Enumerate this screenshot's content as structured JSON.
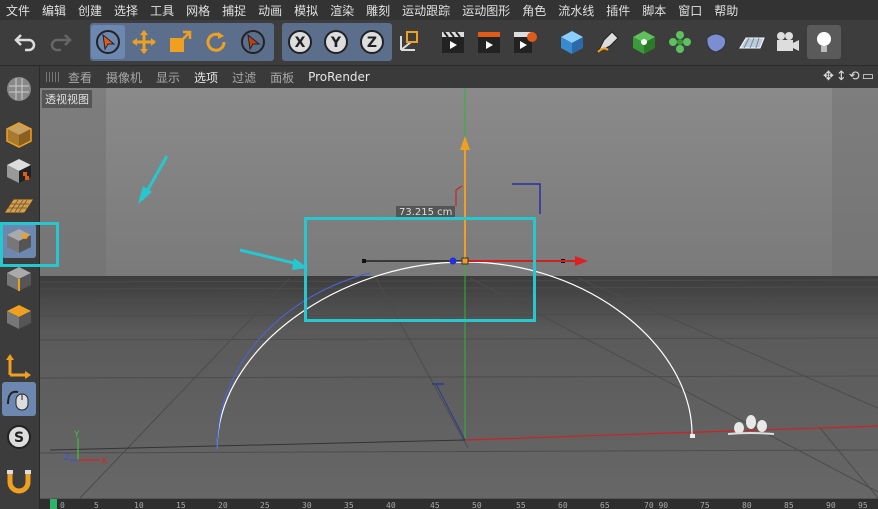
{
  "menu": [
    "文件",
    "编辑",
    "创建",
    "选择",
    "工具",
    "网格",
    "捕捉",
    "动画",
    "模拟",
    "渲染",
    "雕刻",
    "运动跟踪",
    "运动图形",
    "角色",
    "流水线",
    "插件",
    "脚本",
    "窗口",
    "帮助"
  ],
  "viewport_menu": [
    "查看",
    "摄像机",
    "显示",
    "选项",
    "过滤",
    "面板",
    "ProRender"
  ],
  "viewport_label": "透视视图",
  "measure_label": "73.215 cm",
  "axis_labels": {
    "y": "Y",
    "x": "X",
    "z": "Z"
  },
  "timeline_ticks": [
    "0",
    "5",
    "10",
    "15",
    "20",
    "25",
    "30",
    "35",
    "40",
    "45",
    "50",
    "55",
    "60",
    "65",
    "70 90",
    "75",
    "80",
    "85",
    "90",
    "95"
  ],
  "colors": {
    "accent_cyan": "#27c7cf",
    "select_blue": "#6d88b0",
    "axis_y": "#2fb52f",
    "axis_x": "#d22",
    "handle_orange": "#f0a020",
    "spline": "#ffffff"
  },
  "icons": {
    "toolbar": [
      "undo-icon",
      "redo-icon",
      "select-arrow-icon",
      "move-icon",
      "scale-icon",
      "rotate-icon",
      "live-select-icon",
      "x-axis-icon",
      "y-axis-icon",
      "z-axis-icon",
      "coordinate-system-icon",
      "render-view-icon",
      "render-picture-viewer-icon",
      "render-settings-icon",
      "cube-icon",
      "pen-icon",
      "subdivision-icon",
      "cloner-icon",
      "deformer-icon",
      "floor-icon",
      "camera-icon",
      "light-icon"
    ],
    "palette": [
      "make-editable-icon",
      "model-mode-icon",
      "texture-mode-icon",
      "workplane-icon",
      "points-mode-icon",
      "edges-mode-icon",
      "polygons-mode-icon",
      "axis-mode-icon",
      "tweak-icon",
      "snap-icon",
      "magnet-icon"
    ]
  }
}
